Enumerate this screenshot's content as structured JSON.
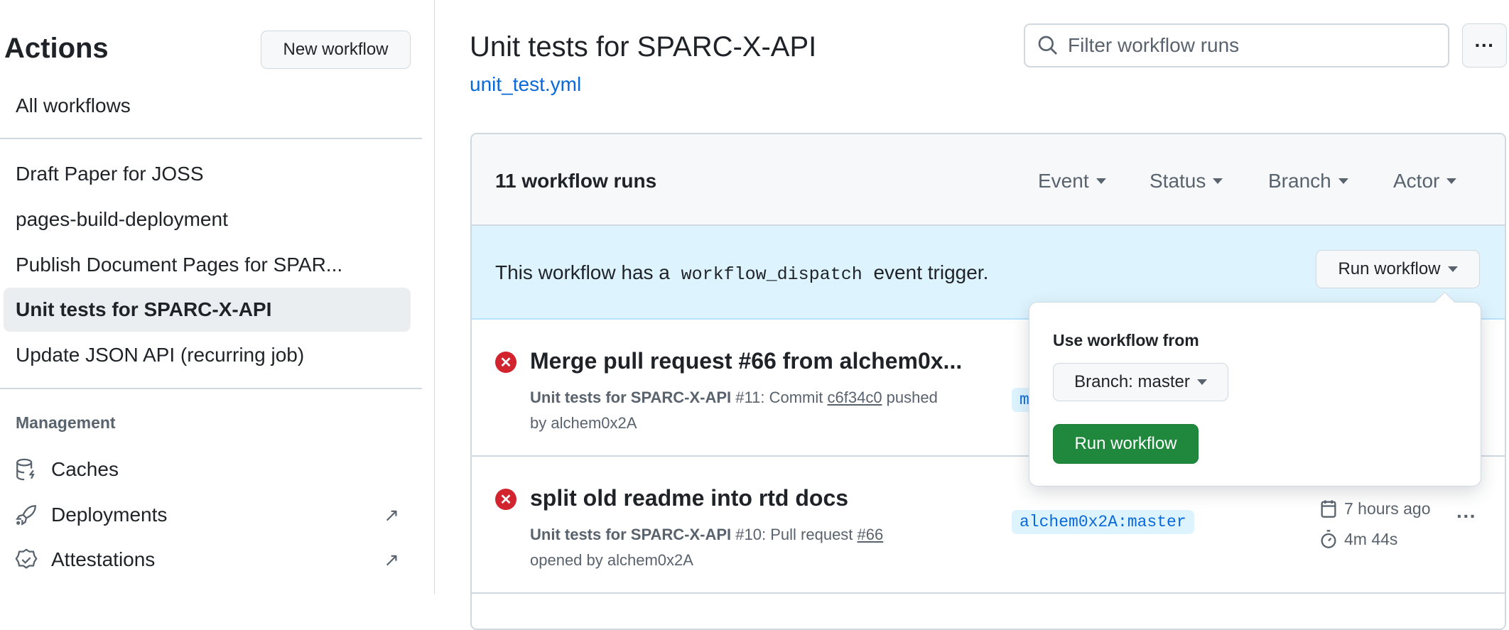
{
  "sidebar": {
    "title": "Actions",
    "new_workflow": "New workflow",
    "all_workflows": "All workflows",
    "workflows": [
      {
        "label": "Draft Paper for JOSS"
      },
      {
        "label": "pages-build-deployment"
      },
      {
        "label": "Publish Document Pages for SPAR..."
      },
      {
        "label": "Unit tests for SPARC-X-API",
        "selected": true
      },
      {
        "label": "Update JSON API (recurring job)"
      }
    ],
    "management_heading": "Management",
    "management": [
      {
        "label": "Caches",
        "icon": "database-icon"
      },
      {
        "label": "Deployments",
        "icon": "rocket-icon",
        "external": "↗"
      },
      {
        "label": "Attestations",
        "icon": "verified-icon",
        "external": "↗"
      }
    ]
  },
  "header": {
    "title": "Unit tests for SPARC-X-API",
    "file_link": "unit_test.yml",
    "filter_placeholder": "Filter workflow runs",
    "more": "···"
  },
  "runs": {
    "count_label": "11 workflow runs",
    "filters": [
      "Event",
      "Status",
      "Branch",
      "Actor"
    ],
    "banner_pre": "This workflow has a",
    "banner_code": "workflow_dispatch",
    "banner_post": "event trigger.",
    "run_workflow_button": "Run workflow",
    "items": [
      {
        "title": "Merge pull request #66 from alchem0x...",
        "workflow": "Unit tests for SPARC-X-API",
        "number": "#11",
        "pre": ": Commit ",
        "ref": "c6f34c0",
        "post": " pushed",
        "line2": "by alchem0x2A",
        "branch": "master",
        "status": "failure"
      },
      {
        "title": "split old readme into rtd docs",
        "workflow": "Unit tests for SPARC-X-API",
        "number": "#10",
        "pre": ": Pull request ",
        "ref": "#66",
        "post": "",
        "line2": "opened by alchem0x2A",
        "branch": "alchem0x2A:master",
        "time": "7 hours ago",
        "duration": "4m 44s",
        "status": "failure"
      }
    ]
  },
  "popover": {
    "heading": "Use workflow from",
    "branch_select": "Branch: master",
    "submit": "Run workflow"
  },
  "colors": {
    "accent": "#0969da",
    "danger": "#d1242f",
    "success": "#1f883d",
    "banner": "#ddf4ff"
  }
}
